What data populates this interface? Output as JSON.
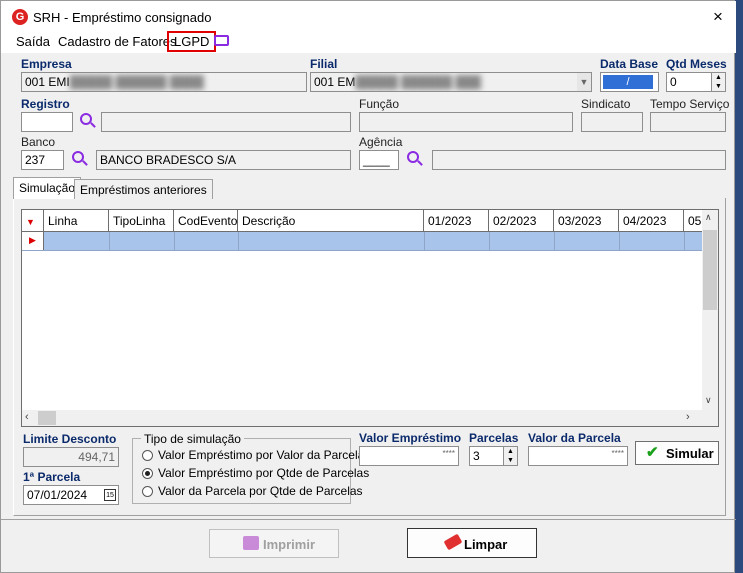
{
  "window": {
    "title": "SRH - Empréstimo consignado",
    "close": "×"
  },
  "menu": {
    "items": [
      "Saída",
      "Cadastro de Fatores",
      "LGPD"
    ]
  },
  "form": {
    "empresa_label": "Empresa",
    "empresa_value": "001 EMI",
    "filial_label": "Filial",
    "filial_value": "001 EM",
    "data_base_label": "Data Base",
    "data_base_value": "/",
    "qtd_meses_label": "Qtd Meses",
    "qtd_meses_value": "0",
    "registro_label": "Registro",
    "funcao_label": "Função",
    "sindicato_label": "Sindicato",
    "tempo_servico_label": "Tempo Serviço",
    "banco_label": "Banco",
    "banco_code": "237",
    "banco_name": "BANCO BRADESCO S/A",
    "agencia_label": "Agência",
    "agencia_value": "____"
  },
  "tabs": [
    {
      "label": "Simulação"
    },
    {
      "label": "Empréstimos anteriores"
    }
  ],
  "grid": {
    "columns": [
      "Linha",
      "TipoLinha",
      "CodEvento",
      "Descrição",
      "01/2023",
      "02/2023",
      "03/2023",
      "04/2023",
      "05"
    ]
  },
  "bottom": {
    "limite_label": "Limite Desconto",
    "limite_value": "494,71",
    "parcela1_label": "1ª Parcela",
    "parcela1_value": "07/01/2024",
    "tipo_sim_label": "Tipo de simulação",
    "tipo_sim_options": [
      {
        "label": "Valor Empréstimo por Valor da Parcela",
        "selected": false
      },
      {
        "label": "Valor Empréstimo por Qtde de Parcelas",
        "selected": true
      },
      {
        "label": "Valor da Parcela por Qtde de Parcelas",
        "selected": false
      }
    ],
    "valor_emprestimo_label": "Valor Empréstimo",
    "valor_emprestimo_value": "****",
    "parcelas_label": "Parcelas",
    "parcelas_value": "3",
    "valor_parcela_label": "Valor da Parcela",
    "valor_parcela_value": "****",
    "simular_label": "Simular"
  },
  "footer": {
    "imprimir_label": "Imprimir",
    "limpar_label": "Limpar"
  },
  "colors": {
    "accent": "#0b2a6b",
    "selected_row": "#a9c4ea",
    "lgpd_border": "#e00000"
  }
}
